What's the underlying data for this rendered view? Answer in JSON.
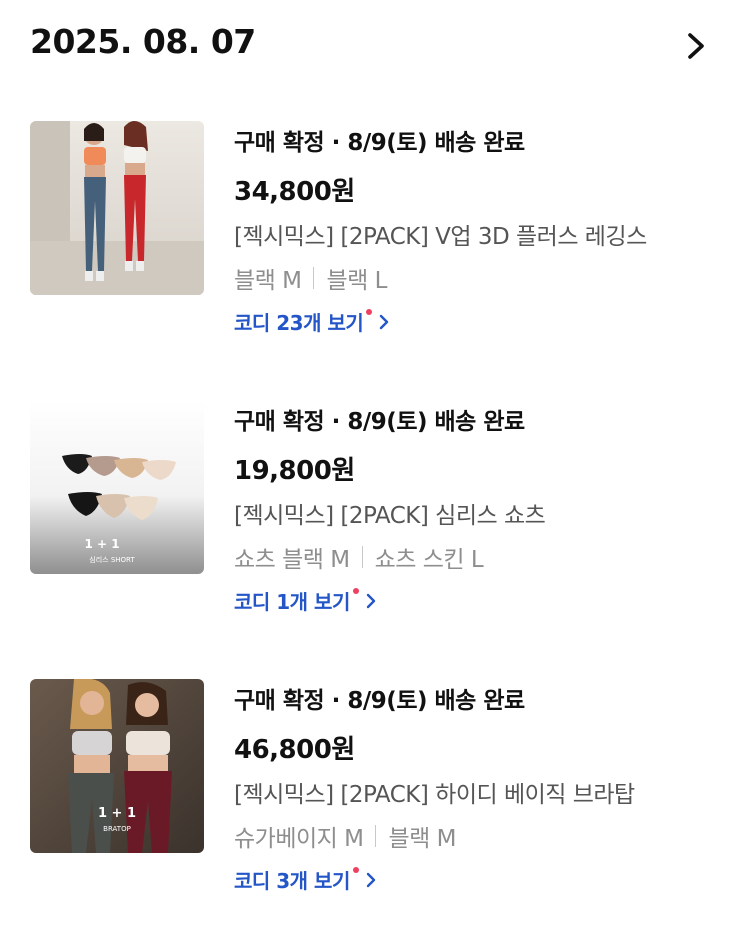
{
  "header": {
    "date": "2025. 08. 07",
    "chevron_icon": "chevron-right-icon"
  },
  "orders": [
    {
      "status": "구매 확정 · 8/9(토) 배송 완료",
      "price": "34,800원",
      "product_name": "[젝시믹스] [2PACK] V업 3D 플러스 레깅스",
      "options": [
        "블랙 M",
        "블랙 L"
      ],
      "coordi_link": "코디 23개 보기",
      "image_caption_main": "",
      "image_caption_sub": ""
    },
    {
      "status": "구매 확정 · 8/9(토) 배송 완료",
      "price": "19,800원",
      "product_name": "[젝시믹스] [2PACK] 심리스 쇼츠",
      "options": [
        "쇼츠 블랙 M",
        "쇼츠 스킨 L"
      ],
      "coordi_link": "코디 1개 보기",
      "image_caption_main": "1 + 1",
      "image_caption_sub": "심리스 SHORT"
    },
    {
      "status": "구매 확정 · 8/9(토) 배송 완료",
      "price": "46,800원",
      "product_name": "[젝시믹스] [2PACK] 하이디 베이직 브라탑",
      "options": [
        "슈가베이지 M",
        "블랙 M"
      ],
      "coordi_link": "코디 3개 보기",
      "image_caption_main": "1 + 1",
      "image_caption_sub": "BRATOP"
    }
  ],
  "colors": {
    "link_blue": "#2456c8",
    "new_dot": "#f04060",
    "text_main": "#111111",
    "text_sub": "#555555",
    "text_muted": "#8e8e8e"
  }
}
